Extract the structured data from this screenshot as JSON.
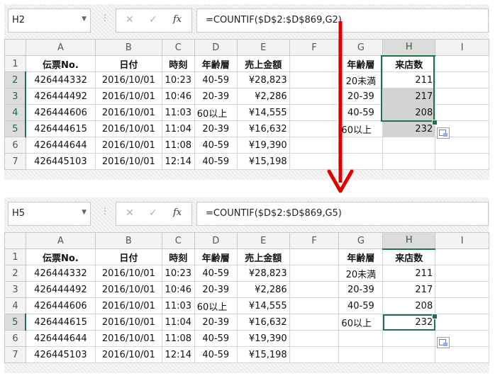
{
  "colors": {
    "accent": "#217346",
    "arrow": "#e00000",
    "shade": "#d3d3d3"
  },
  "icons": {
    "cancel": "cancel-x-icon",
    "enter": "enter-check-icon",
    "function": "fx-icon",
    "quick_analysis": "quick-analysis-icon"
  },
  "formula_bar": {
    "cancel_glyph": "✕",
    "enter_glyph": "✓",
    "fx_glyph": "fx",
    "dots": "⋮",
    "dropdown": "▼"
  },
  "columns": [
    "A",
    "B",
    "C",
    "D",
    "E",
    "F",
    "G",
    "H",
    "I"
  ],
  "rows": [
    {
      "num": "1",
      "A": "伝票No.",
      "B": "日付",
      "C": "時刻",
      "D": "年齢層",
      "E": "売上金額",
      "G": "年齢層",
      "H": "来店数"
    },
    {
      "num": "2",
      "A": "426444332",
      "B": "2016/10/01",
      "C": "10:23",
      "D": "40-59",
      "E": "¥28,823",
      "G": "20未満",
      "H": "211"
    },
    {
      "num": "3",
      "A": "426444492",
      "B": "2016/10/01",
      "C": "10:46",
      "D": "20-39",
      "E": "¥2,286",
      "G": "20-39",
      "H": "217"
    },
    {
      "num": "4",
      "A": "426444606",
      "B": "2016/10/01",
      "C": "11:03",
      "D": "60以上",
      "E": "¥14,555",
      "G": "40-59",
      "H": "208"
    },
    {
      "num": "5",
      "A": "426444615",
      "B": "2016/10/01",
      "C": "11:04",
      "D": "20-39",
      "E": "¥16,632",
      "G": "60以上",
      "H": "232"
    },
    {
      "num": "6",
      "A": "426444644",
      "B": "2016/10/01",
      "C": "11:08",
      "D": "40-59",
      "E": "¥19,390",
      "G": "",
      "H": ""
    },
    {
      "num": "7",
      "A": "426445103",
      "B": "2016/10/01",
      "C": "12:14",
      "D": "40-59",
      "E": "¥15,198",
      "G": "",
      "H": ""
    }
  ],
  "top": {
    "name_box": "H2",
    "formula": "=COUNTIF($D$2:$D$869,G2)"
  },
  "bottom": {
    "name_box": "H5",
    "formula": "=COUNTIF($D$2:$D$869,G5)"
  }
}
